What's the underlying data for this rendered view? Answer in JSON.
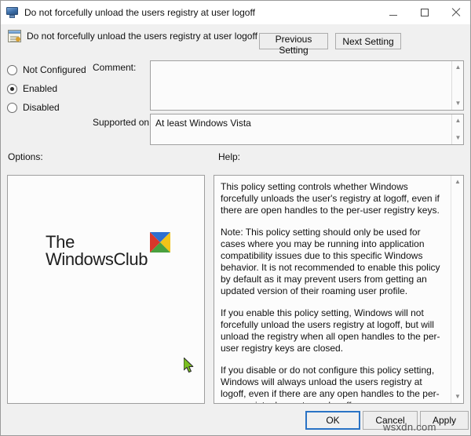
{
  "window": {
    "title": "Do not forcefully unload the users registry at user logoff",
    "icon": "monitor-icon",
    "controls": {
      "minimize": "—",
      "maximize": "□",
      "close": "✕"
    }
  },
  "header": {
    "policy_icon": "policy-setting-icon",
    "policy_title": "Do not forcefully unload the users registry at user logoff",
    "previous_setting": "Previous Setting",
    "next_setting": "Next Setting"
  },
  "state_options": [
    {
      "label": "Not Configured",
      "selected": false
    },
    {
      "label": "Enabled",
      "selected": true
    },
    {
      "label": "Disabled",
      "selected": false
    }
  ],
  "fields": {
    "comment_label": "Comment:",
    "comment_value": "",
    "supported_label": "Supported on:",
    "supported_value": "At least Windows Vista"
  },
  "sections": {
    "options_label": "Options:",
    "help_label": "Help:"
  },
  "options_panel": {
    "logo_line1": "The",
    "logo_line2": "WindowsClub",
    "logo_mark": "four-color-square-icon"
  },
  "help_text": [
    "This policy setting  controls whether Windows forcefully unloads the user's registry at logoff, even if there are open handles to the per-user registry keys.",
    "Note: This policy setting should only be used for cases where you may be running into application compatibility issues due to this specific Windows behavior. It is not recommended to enable this policy by default as it may prevent users from getting an updated version of their roaming user profile.",
    "If you enable this policy setting, Windows will not forcefully unload the users registry at logoff, but will unload the registry when all open handles to the per-user registry keys are closed.",
    "If you disable or do not configure this policy setting, Windows will always unload the users registry at logoff, even if there are any open handles to the per-user registry keys at user logoff."
  ],
  "footer": {
    "ok": "OK",
    "cancel": "Cancel",
    "apply": "Apply"
  },
  "watermark": "wsxdn.com",
  "colors": {
    "accent": "#2a73c5",
    "window_bg": "#f0f0f0",
    "panel_bg": "#fcfcfc",
    "cursor": "#7ac01f"
  }
}
